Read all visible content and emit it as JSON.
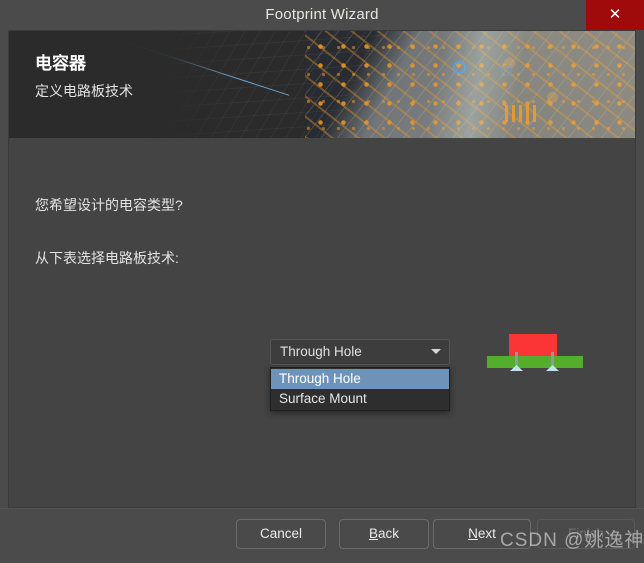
{
  "window": {
    "title": "Footprint Wizard",
    "close_label": "✕"
  },
  "banner": {
    "title": "电容器",
    "subtitle": "定义电路板技术"
  },
  "body": {
    "prompt_1": "您希望设计的电容类型?",
    "prompt_2": "从下表选择电路板技术:"
  },
  "combo": {
    "value": "Through Hole",
    "expanded": true,
    "options": [
      {
        "label": "Through Hole",
        "selected": true
      },
      {
        "label": "Surface Mount",
        "selected": false
      }
    ]
  },
  "preview": {
    "body_color": "#fb3535",
    "board_color": "#54ad2b",
    "pin_color": "#8e9aa2",
    "fillet_color": "#bfe3ef"
  },
  "footer": {
    "cancel": "Cancel",
    "back_prefix": "",
    "back_mnemonic": "B",
    "back_suffix": "ack",
    "next_mnemonic": "N",
    "next_suffix": "ext",
    "finish": "Finish"
  },
  "watermark": {
    "text": "CSDN @姚逸神"
  },
  "colors": {
    "accent_highlight": "#6d94b8",
    "close_button": "#a10a0a",
    "panel": "#444444",
    "chrome": "#4b4b4b",
    "banner": "#2b2b2b"
  }
}
